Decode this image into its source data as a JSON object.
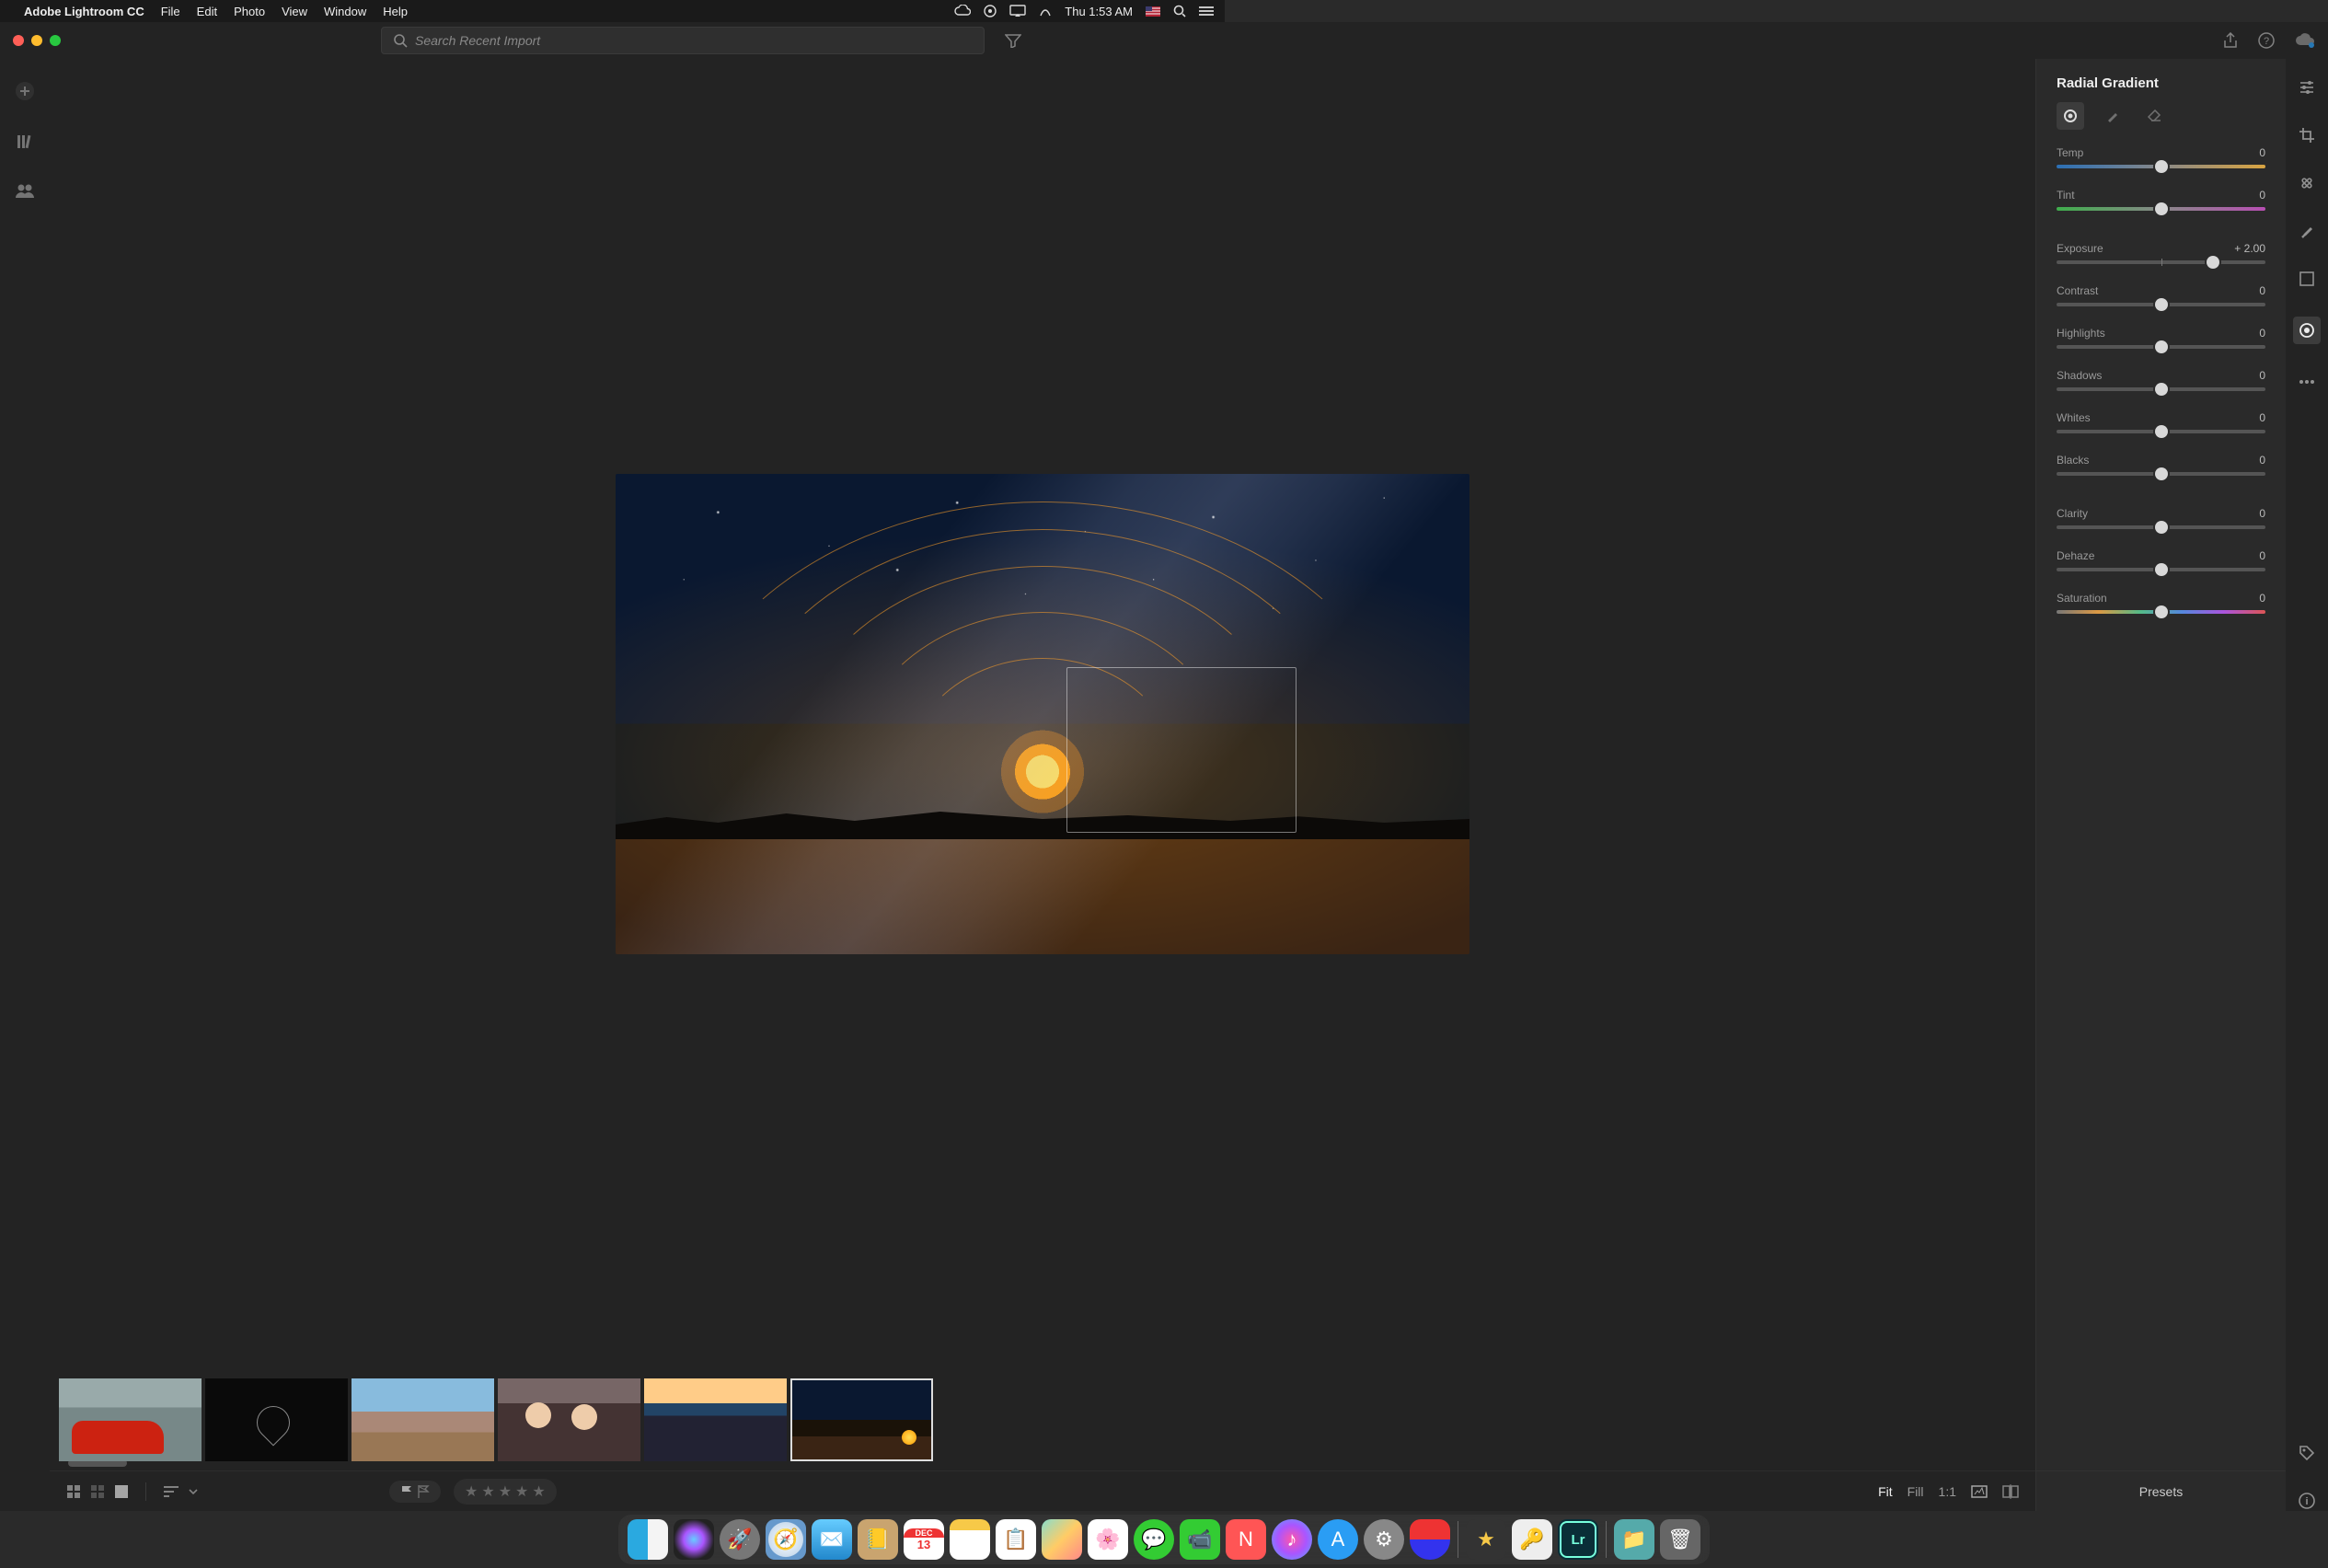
{
  "os": {
    "menubar": {
      "app_name": "Adobe Lightroom CC",
      "menus": [
        "File",
        "Edit",
        "Photo",
        "View",
        "Window",
        "Help"
      ],
      "clock": "Thu 1:53 AM"
    },
    "dock": {
      "items": [
        "finder",
        "siri",
        "launchpad",
        "safari",
        "mail",
        "contacts",
        "calendar",
        "notes",
        "reminders",
        "maps",
        "photos",
        "messages",
        "facetime",
        "news",
        "itunes",
        "appstore",
        "system-preferences",
        "magnet"
      ],
      "items_after_sep": [
        "imovie",
        "1password",
        "lightroom"
      ],
      "items_after_sep2": [
        "downloads",
        "trash"
      ],
      "calendar": {
        "month": "DEC",
        "day": "13"
      }
    }
  },
  "window": {
    "search_placeholder": "Search Recent Import"
  },
  "panel": {
    "title": "Radial Gradient",
    "sliders": [
      {
        "key": "temp",
        "label": "Temp",
        "value": "0",
        "pos": 50,
        "track": "tr-temp"
      },
      {
        "key": "tint",
        "label": "Tint",
        "value": "0",
        "pos": 50,
        "track": "tr-tint"
      },
      {
        "key": "exposure",
        "label": "Exposure",
        "value": "+ 2.00",
        "pos": 75,
        "track": "tr-gray"
      },
      {
        "key": "contrast",
        "label": "Contrast",
        "value": "0",
        "pos": 50,
        "track": "tr-gray"
      },
      {
        "key": "highlights",
        "label": "Highlights",
        "value": "0",
        "pos": 50,
        "track": "tr-gray"
      },
      {
        "key": "shadows",
        "label": "Shadows",
        "value": "0",
        "pos": 50,
        "track": "tr-gray"
      },
      {
        "key": "whites",
        "label": "Whites",
        "value": "0",
        "pos": 50,
        "track": "tr-gray"
      },
      {
        "key": "blacks",
        "label": "Blacks",
        "value": "0",
        "pos": 50,
        "track": "tr-gray"
      },
      {
        "key": "clarity",
        "label": "Clarity",
        "value": "0",
        "pos": 50,
        "track": "tr-gray"
      },
      {
        "key": "dehaze",
        "label": "Dehaze",
        "value": "0",
        "pos": 50,
        "track": "tr-gray"
      },
      {
        "key": "saturation",
        "label": "Saturation",
        "value": "0",
        "pos": 50,
        "track": "tr-sat"
      }
    ],
    "presets_label": "Presets"
  },
  "bottombar": {
    "zoom": {
      "fit": "Fit",
      "fill": "Fill",
      "one": "1:1",
      "active": "fit"
    }
  },
  "filmstrip": {
    "count": 6,
    "selected_index": 5
  }
}
